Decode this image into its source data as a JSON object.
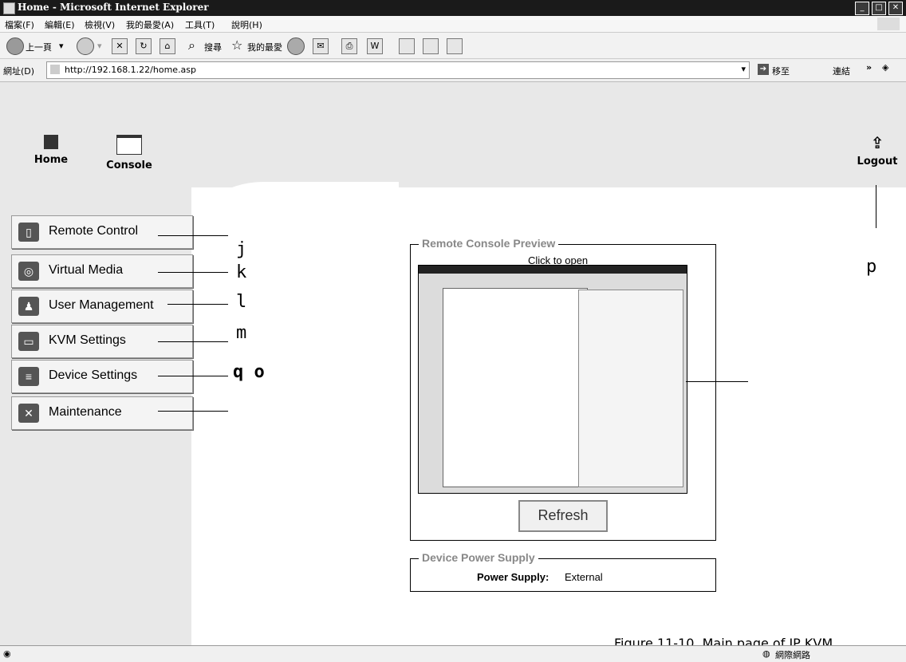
{
  "window": {
    "title": "Home - Microsoft Internet Explorer"
  },
  "menu": [
    "檔案(F)",
    "編輯(E)",
    "檢視(V)",
    "我的最愛(A)",
    "工具(T)",
    "說明(H)"
  ],
  "toolbar": {
    "back": "上一頁",
    "search": "搜尋",
    "favorites": "我的最愛"
  },
  "address": {
    "label": "網址(D)",
    "url": "http://192.168.1.22/home.asp",
    "go": "移至",
    "links": "連結"
  },
  "header": {
    "home": "Home",
    "console": "Console",
    "logout": "Logout"
  },
  "nav": [
    {
      "label": "Remote Control",
      "icon": "remote-control-icon"
    },
    {
      "label": "Virtual Media",
      "icon": "virtual-media-icon"
    },
    {
      "label": "User Management",
      "icon": "user-management-icon"
    },
    {
      "label": "KVM Settings",
      "icon": "kvm-settings-icon"
    },
    {
      "label": "Device Settings",
      "icon": "device-settings-icon"
    },
    {
      "label": "Maintenance",
      "icon": "maintenance-icon"
    }
  ],
  "callouts": {
    "j": "j",
    "k": "k",
    "l": "l",
    "m": "m",
    "qo": "q o",
    "p": "p"
  },
  "preview": {
    "legend": "Remote Console Preview",
    "link": "Click to open",
    "refresh": "Refresh"
  },
  "power": {
    "legend": "Device Power Supply",
    "label": "Power Supply:",
    "value": "External"
  },
  "caption": "Figure 11-10. Main page of IP KVM",
  "status": {
    "zone": "網際網路"
  }
}
